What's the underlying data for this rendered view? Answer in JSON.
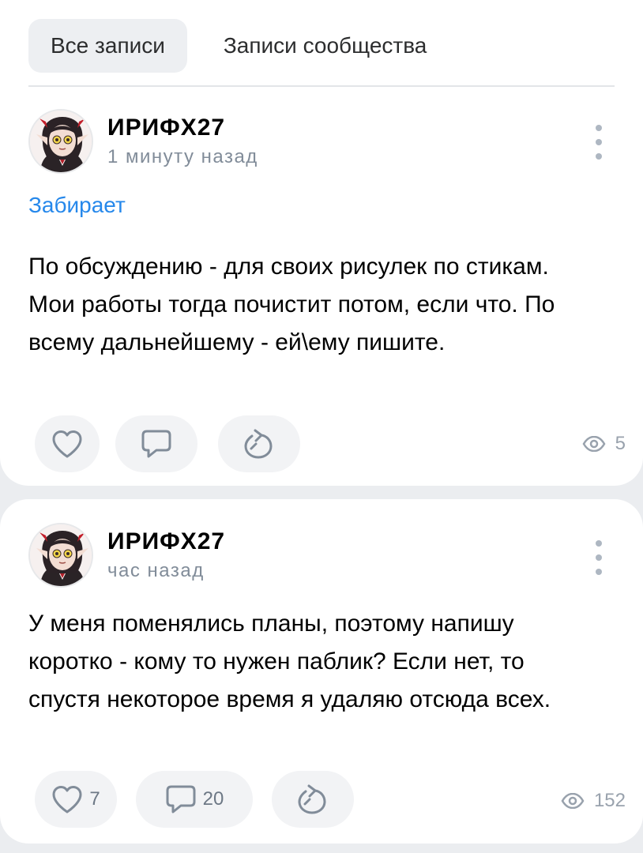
{
  "tabs": [
    {
      "label": "Все записи",
      "active": true
    },
    {
      "label": "Записи сообщества",
      "active": false
    }
  ],
  "posts": [
    {
      "author": "ИРИФХ27",
      "time": "1 минуту назад",
      "source_link": "Забирает",
      "text": "По обсуждению - для своих рисулек по стикам. Мои работы тогда почистит потом, если что. По всему дальнейшему - ей\\ему пишите.",
      "likes": "",
      "comments": "",
      "views": "5"
    },
    {
      "author": "ИРИФХ27",
      "time": "час назад",
      "text": "У меня поменялись планы, поэтому напишу коротко - кому то нужен паблик? Если нет, то спустя некоторое время я удаляю отсюда всех.",
      "likes": "7",
      "comments": "20",
      "views": "152"
    }
  ],
  "icons": {
    "like": "heart-icon",
    "comment": "comment-bubble-icon",
    "share": "share-arrow-icon",
    "views": "eye-icon",
    "more": "more-vertical-icon"
  },
  "colors": {
    "accent": "#2688eb",
    "background": "#ebedf0",
    "card": "#ffffff",
    "secondary_text": "#818c99"
  }
}
